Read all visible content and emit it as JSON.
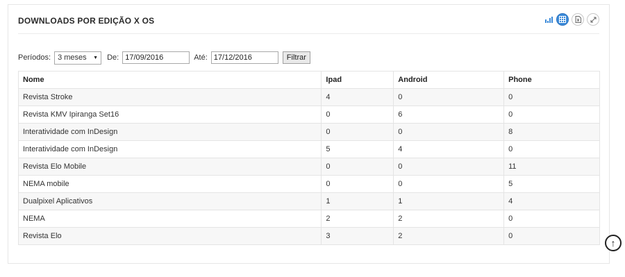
{
  "panel": {
    "title": "DOWNLOADS POR EDIÇÃO X OS",
    "icons": [
      "bar-chart-icon",
      "table-icon",
      "excel-export-icon",
      "expand-icon"
    ]
  },
  "filters": {
    "period_label": "Períodos:",
    "period_value": "3 meses",
    "from_label": "De:",
    "from_value": "17/09/2016",
    "to_label": "Até:",
    "to_value": "17/12/2016",
    "filter_button": "Filtrar"
  },
  "table": {
    "headers": [
      "Nome",
      "Ipad",
      "Android",
      "Phone"
    ],
    "rows": [
      [
        "Revista Stroke",
        "4",
        "0",
        "0"
      ],
      [
        "Revista KMV Ipiranga Set16",
        "0",
        "6",
        "0"
      ],
      [
        "Interatividade com InDesign",
        "0",
        "0",
        "8"
      ],
      [
        "Interatividade com InDesign",
        "5",
        "4",
        "0"
      ],
      [
        "Revista Elo Mobile",
        "0",
        "0",
        "11"
      ],
      [
        "NEMA mobile",
        "0",
        "0",
        "5"
      ],
      [
        "Dualpixel Aplicativos",
        "1",
        "1",
        "4"
      ],
      [
        "NEMA",
        "2",
        "2",
        "0"
      ],
      [
        "Revista Elo",
        "3",
        "2",
        "0"
      ]
    ]
  },
  "colors": {
    "accent": "#3b8ad9"
  }
}
